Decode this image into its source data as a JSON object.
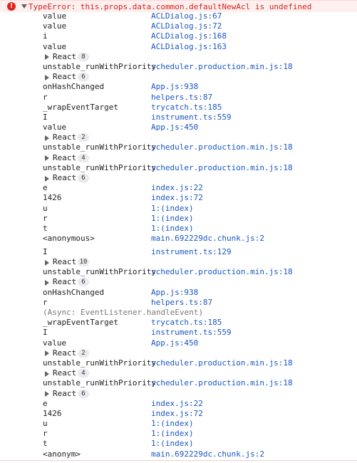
{
  "error": {
    "icon": "error-icon",
    "message": "TypeError: this.props.data.common.defaultNewAcl is undefined"
  },
  "frames": [
    {
      "kind": "frame",
      "fn": "value",
      "loc": "ACLDialog.js:67"
    },
    {
      "kind": "frame",
      "fn": "value",
      "loc": "ACLDialog.js:72"
    },
    {
      "kind": "frame",
      "fn": "i",
      "loc": "ACLDialog.js:168"
    },
    {
      "kind": "frame",
      "fn": "value",
      "loc": "ACLDialog.js:163"
    },
    {
      "kind": "group",
      "label": "React",
      "count": "8"
    },
    {
      "kind": "frame",
      "fn": "unstable_runWithPriority",
      "loc": "scheduler.production.min.js:18"
    },
    {
      "kind": "group",
      "label": "React",
      "count": "6"
    },
    {
      "kind": "frame",
      "fn": "onHashChanged",
      "loc": "App.js:938"
    },
    {
      "kind": "frame",
      "fn": "r",
      "loc": "helpers.ts:87"
    },
    {
      "kind": "frame",
      "fn": "_wrapEventTarget",
      "loc": "trycatch.ts:185"
    },
    {
      "kind": "frame",
      "fn": "I",
      "loc": "instrument.ts:559"
    },
    {
      "kind": "frame",
      "fn": "value",
      "loc": "App.js:450"
    },
    {
      "kind": "group",
      "label": "React",
      "count": "2"
    },
    {
      "kind": "frame",
      "fn": "unstable_runWithPriority",
      "loc": "scheduler.production.min.js:18"
    },
    {
      "kind": "group",
      "label": "React",
      "count": "4"
    },
    {
      "kind": "frame",
      "fn": "unstable_runWithPriority",
      "loc": "scheduler.production.min.js:18"
    },
    {
      "kind": "group",
      "label": "React",
      "count": "6"
    },
    {
      "kind": "frame",
      "fn": "e",
      "loc": "index.js:22"
    },
    {
      "kind": "frame",
      "fn": "1426",
      "loc": "index.js:72"
    },
    {
      "kind": "frame",
      "fn": "u",
      "loc": "1:(index)"
    },
    {
      "kind": "frame",
      "fn": "r",
      "loc": "1:(index)"
    },
    {
      "kind": "frame",
      "fn": "t",
      "loc": "1:(index)"
    },
    {
      "kind": "frame",
      "fn": "<anonymous>",
      "loc": "main.692229dc.chunk.js:2"
    },
    {
      "kind": "spacer"
    },
    {
      "kind": "frame",
      "fn": "I",
      "loc": "instrument.ts:129"
    },
    {
      "kind": "group",
      "label": "React",
      "count": "10"
    },
    {
      "kind": "frame",
      "fn": "unstable_runWithPriority",
      "loc": "scheduler.production.min.js:18"
    },
    {
      "kind": "group",
      "label": "React",
      "count": "6"
    },
    {
      "kind": "frame",
      "fn": "onHashChanged",
      "loc": "App.js:938"
    },
    {
      "kind": "frame",
      "fn": "r",
      "loc": "helpers.ts:87"
    },
    {
      "kind": "async",
      "text": "(Async: EventListener.handleEvent)"
    },
    {
      "kind": "frame",
      "fn": "_wrapEventTarget",
      "loc": "trycatch.ts:185"
    },
    {
      "kind": "frame",
      "fn": "I",
      "loc": "instrument.ts:559"
    },
    {
      "kind": "frame",
      "fn": "value",
      "loc": "App.js:450"
    },
    {
      "kind": "group",
      "label": "React",
      "count": "2"
    },
    {
      "kind": "frame",
      "fn": "unstable_runWithPriority",
      "loc": "scheduler.production.min.js:18"
    },
    {
      "kind": "group",
      "label": "React",
      "count": "4"
    },
    {
      "kind": "frame",
      "fn": "unstable_runWithPriority",
      "loc": "scheduler.production.min.js:18"
    },
    {
      "kind": "group",
      "label": "React",
      "count": "6"
    },
    {
      "kind": "frame",
      "fn": "e",
      "loc": "index.js:22"
    },
    {
      "kind": "frame",
      "fn": "1426",
      "loc": "index.js:72"
    },
    {
      "kind": "frame",
      "fn": "u",
      "loc": "1:(index)"
    },
    {
      "kind": "frame",
      "fn": "r",
      "loc": "1:(index)"
    },
    {
      "kind": "frame",
      "fn": "t",
      "loc": "1:(index)"
    },
    {
      "kind": "frame",
      "fn": "<anonym>",
      "loc": "main.692229dc.chunk.js:2"
    }
  ],
  "colors": {
    "error_text": "#d1221b",
    "link": "#1a56c5",
    "async_text": "#7a7a7a",
    "badge_bg": "#e8eaed"
  }
}
